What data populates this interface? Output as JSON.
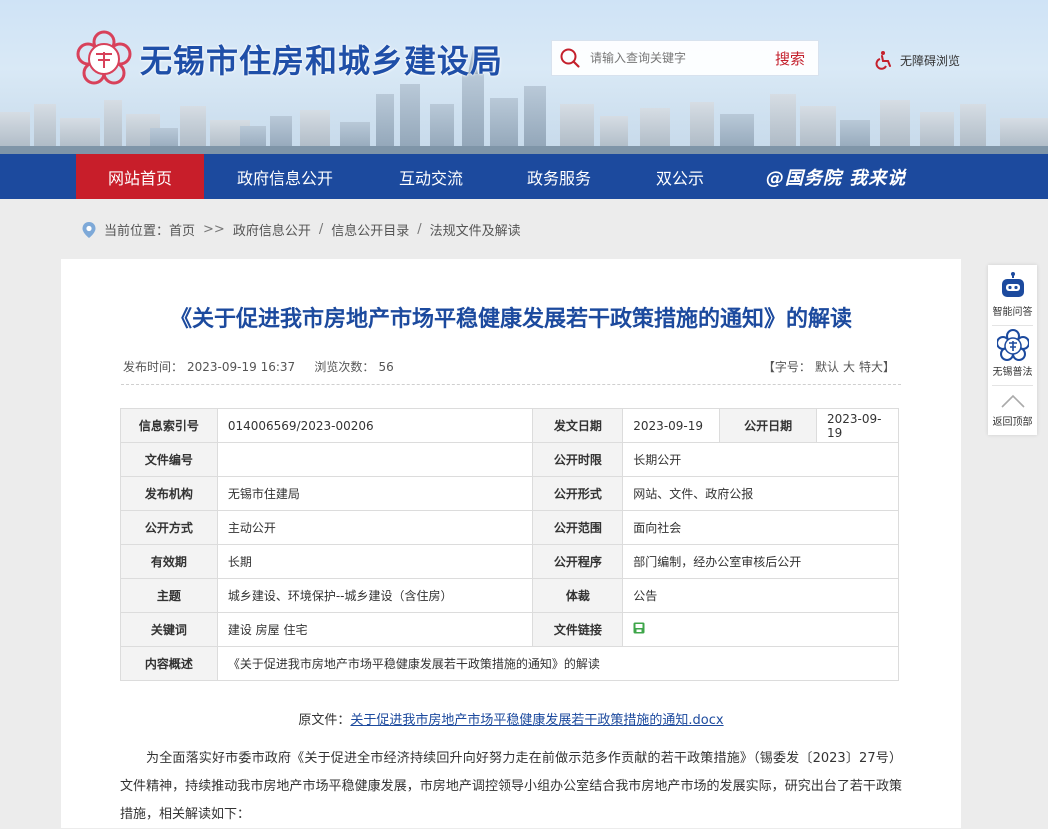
{
  "header": {
    "site_title": "无锡市住房和城乡建设局",
    "search_placeholder": "请输入查询关键字",
    "search_button": "搜索",
    "accessibility": "无障碍浏览"
  },
  "nav": {
    "items": [
      "网站首页",
      "政府信息公开",
      "互动交流",
      "政务服务",
      "双公示"
    ],
    "active_index": 0,
    "slogan": "@国务院 我来说"
  },
  "breadcrumb": {
    "label": "当前位置：",
    "items": [
      "首页",
      "政府信息公开",
      "信息公开目录",
      "法规文件及解读"
    ],
    "separators": [
      ">>",
      "/",
      "/"
    ]
  },
  "article": {
    "title": "《关于促进我市房地产市场平稳健康发展若干政策措施的通知》的解读",
    "publish_label": "发布时间：",
    "publish_time": "2023-09-19 16:37",
    "views_label": "浏览次数：",
    "views": "56",
    "fontsize": {
      "prefix": "【字号：",
      "options": [
        "默认",
        "大",
        "特大"
      ],
      "suffix": "】"
    },
    "info": {
      "index_no_label": "信息索引号",
      "index_no": "014006569/2023-00206",
      "issue_date_label": "发文日期",
      "issue_date": "2023-09-19",
      "public_date_label": "公开日期",
      "public_date": "2023-09-19",
      "doc_no_label": "文件编号",
      "doc_no": "",
      "public_period_label": "公开时限",
      "public_period": "长期公开",
      "issuer_label": "发布机构",
      "issuer": "无锡市住建局",
      "public_form_label": "公开形式",
      "public_form": "网站、文件、政府公报",
      "public_mode_label": "公开方式",
      "public_mode": "主动公开",
      "public_scope_label": "公开范围",
      "public_scope": "面向社会",
      "validity_label": "有效期",
      "validity": "长期",
      "public_procedure_label": "公开程序",
      "public_procedure": "部门编制，经办公室审核后公开",
      "topic_label": "主题",
      "topic": "城乡建设、环境保护--城乡建设（含住房）",
      "genre_label": "体裁",
      "genre": "公告",
      "keywords_label": "关键词",
      "keywords": "建设 房屋 住宅",
      "file_link_label": "文件链接",
      "summary_label": "内容概述",
      "summary": "《关于促进我市房地产市场平稳健康发展若干政策措施的通知》的解读"
    },
    "source_label": "原文件：",
    "source_link": "关于促进我市房地产市场平稳健康发展若干政策措施的通知.docx",
    "body": "为全面落实好市委市政府《关于促进全市经济持续回升向好努力走在前做示范多作贡献的若干政策措施》（锡委发〔2023〕27号）文件精神，持续推动我市房地产市场平稳健康发展，市房地产调控领导小组办公室结合我市房地产市场的发展实际，研究出台了若干政策措施，相关解读如下："
  },
  "side_tools": {
    "smart_qa": "智能问答",
    "wuxi_law": "无锡普法",
    "back_to_top": "返回顶部"
  },
  "colors": {
    "nav_blue": "#1c4a9e",
    "nav_active_red": "#c81e2a",
    "title_blue": "#1c4a9e",
    "search_red": "#c4202c"
  }
}
